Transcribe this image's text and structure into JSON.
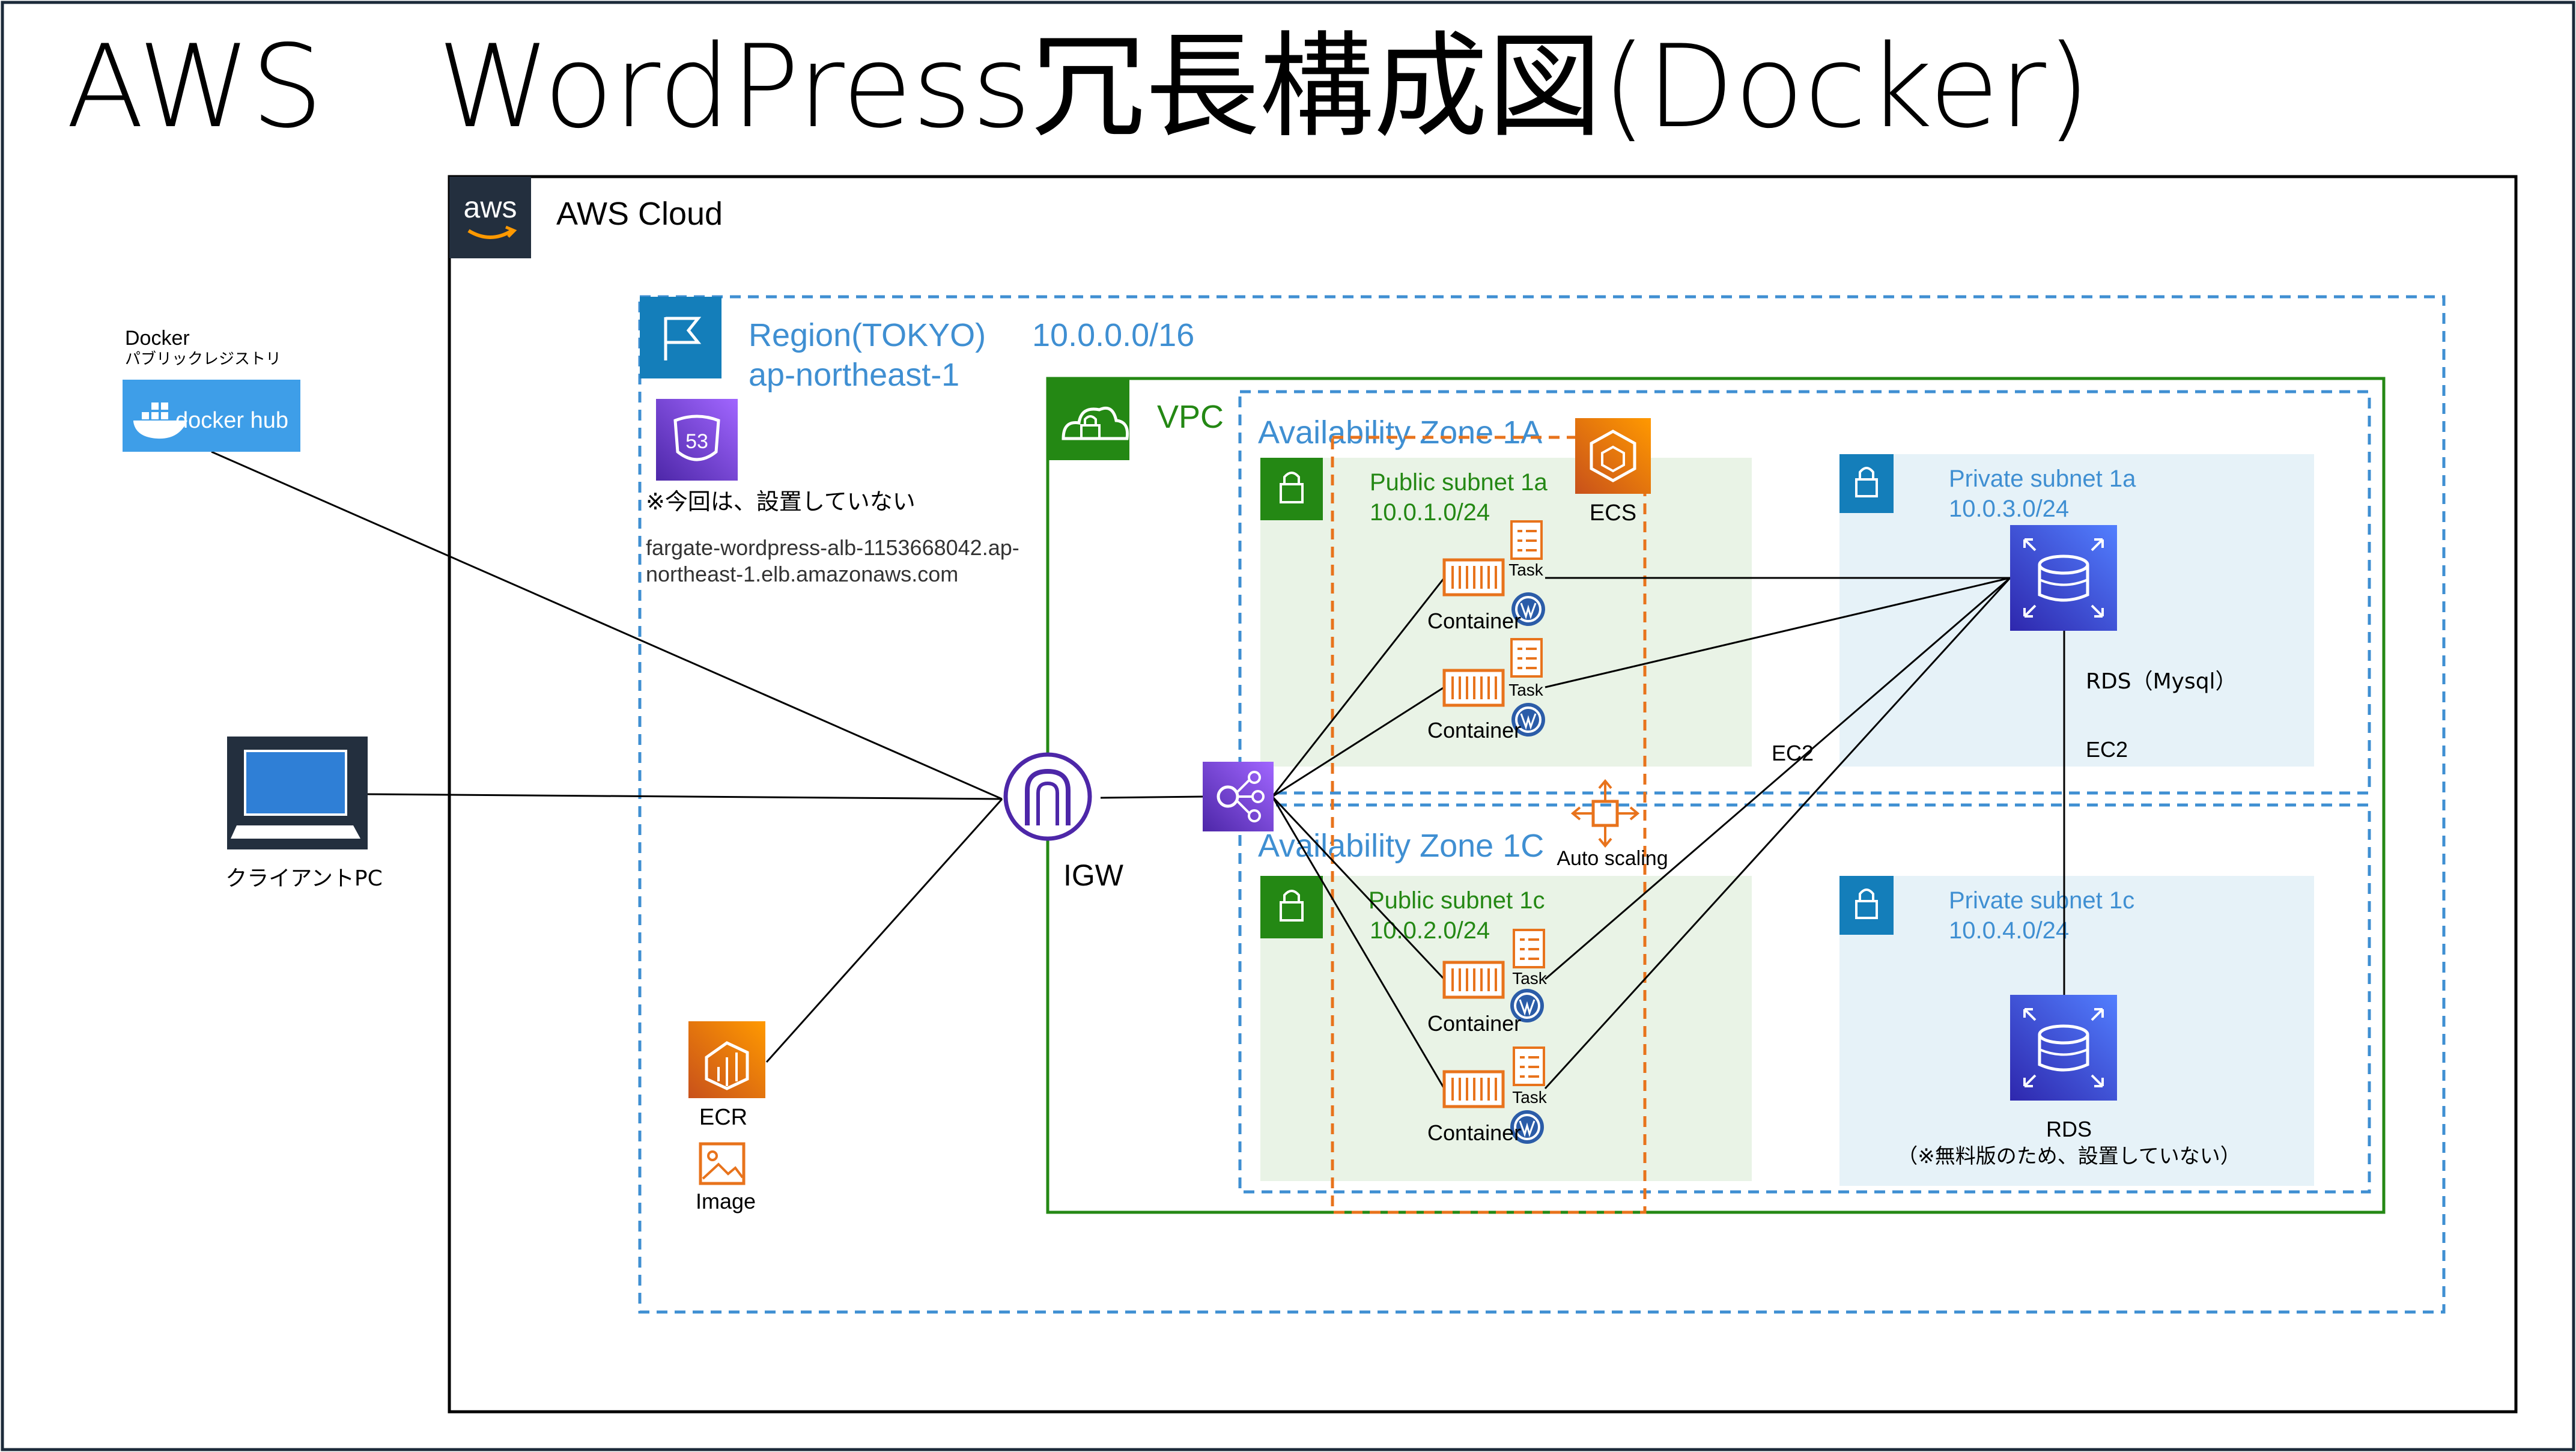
{
  "title": "AWS　WordPress冗長構成図(Docker)",
  "aws_cloud": {
    "label": "AWS Cloud",
    "logo_text": "aws"
  },
  "region": {
    "name": "Region(TOKYO)",
    "code": "ap-northeast-1",
    "cidr": "10.0.0.0/16"
  },
  "route53": {
    "icon_text": "53",
    "note": "※今回は、設置していない"
  },
  "alb_dns": {
    "line1": "fargate-wordpress-alb-1153668042.ap-",
    "line2": "northeast-1.elb.amazonaws.com"
  },
  "docker": {
    "title": "Docker",
    "subtitle": "パブリックレジストリ",
    "logo_text": "docker hub"
  },
  "client": {
    "label": "クライアントPC"
  },
  "vpc": {
    "label": "VPC"
  },
  "igw": {
    "label": "IGW"
  },
  "ecr": {
    "label": "ECR",
    "image_label": "Image"
  },
  "ecs": {
    "label": "ECS"
  },
  "autoscaling": {
    "label": "Auto scaling"
  },
  "az1": {
    "label": "Availability Zone 1A"
  },
  "az2": {
    "label": "Availability Zone 1C"
  },
  "pub1": {
    "name": "Public subnet 1a",
    "cidr": "10.0.1.0/24"
  },
  "pub2": {
    "name": "Public subnet 1c",
    "cidr": "10.0.2.0/24"
  },
  "priv1": {
    "name": "Private subnet 1a",
    "cidr": "10.0.3.0/24"
  },
  "priv2": {
    "name": "Private subnet 1c",
    "cidr": "10.0.4.0/24"
  },
  "rds1": {
    "label": "RDS（Mysql）",
    "ec2_label": "EC2"
  },
  "rds2": {
    "label": "RDS",
    "note": "（※無料版のため、設置していない）"
  },
  "ec2_mid_label": "EC2",
  "task_label": "Task",
  "container_label": "Container",
  "colors": {
    "region_blue": "#3f8fd2",
    "vpc_green": "#248814",
    "subnet_green_fill": "#e9f3e6",
    "subnet_blue_fill": "#e6f2f8",
    "orange": "#e8731c",
    "purple": "#7b3fe4",
    "rds_blue": "#3334b9",
    "aws_dark": "#232f3e"
  }
}
